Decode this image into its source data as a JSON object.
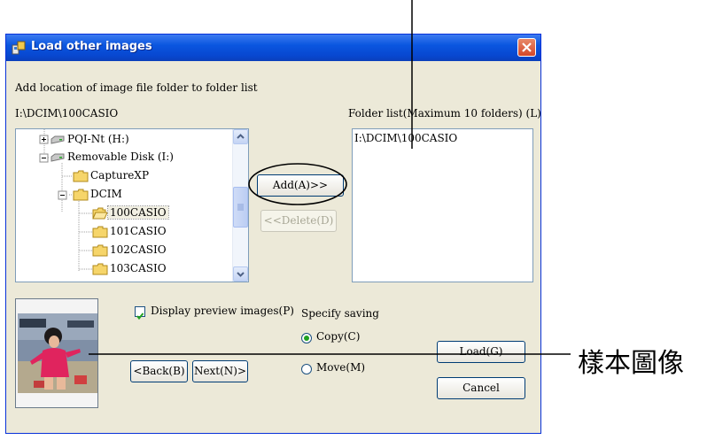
{
  "window": {
    "title": "Load other images"
  },
  "instructions": "Add location of image file folder to folder list",
  "current_path": "I:\\DCIM\\100CASIO",
  "folder_list": {
    "label": "Folder list(Maximum 10 folders) (L)",
    "items": [
      "I:\\DCIM\\100CASIO"
    ]
  },
  "tree": {
    "items": [
      {
        "label": "PQI-Nt (H:)",
        "icon": "drive-icon",
        "expander": "+"
      },
      {
        "label": "Removable Disk (I:)",
        "icon": "drive-icon",
        "expander": "-"
      },
      {
        "label": "CaptureXP",
        "icon": "folder-icon",
        "expander": ""
      },
      {
        "label": "DCIM",
        "icon": "folder-icon",
        "expander": "-"
      },
      {
        "label": "100CASIO",
        "icon": "folder-open-icon",
        "expander": "",
        "selected": true
      },
      {
        "label": "101CASIO",
        "icon": "folder-icon",
        "expander": ""
      },
      {
        "label": "102CASIO",
        "icon": "folder-icon",
        "expander": ""
      },
      {
        "label": "103CASIO",
        "icon": "folder-icon",
        "expander": ""
      }
    ]
  },
  "buttons": {
    "add": "Add(A)>>",
    "delete": "<<Delete(D)",
    "back": "<Back(B)",
    "next": "Next(N)>",
    "load": "Load(G)",
    "cancel": "Cancel"
  },
  "display_preview": {
    "label": "Display preview images(P)",
    "checked": true
  },
  "saving": {
    "label": "Specify saving",
    "options": [
      {
        "label": "Copy(C)",
        "selected": true
      },
      {
        "label": "Move(M)",
        "selected": false
      }
    ]
  },
  "callout": {
    "label": "樣本圖像"
  }
}
